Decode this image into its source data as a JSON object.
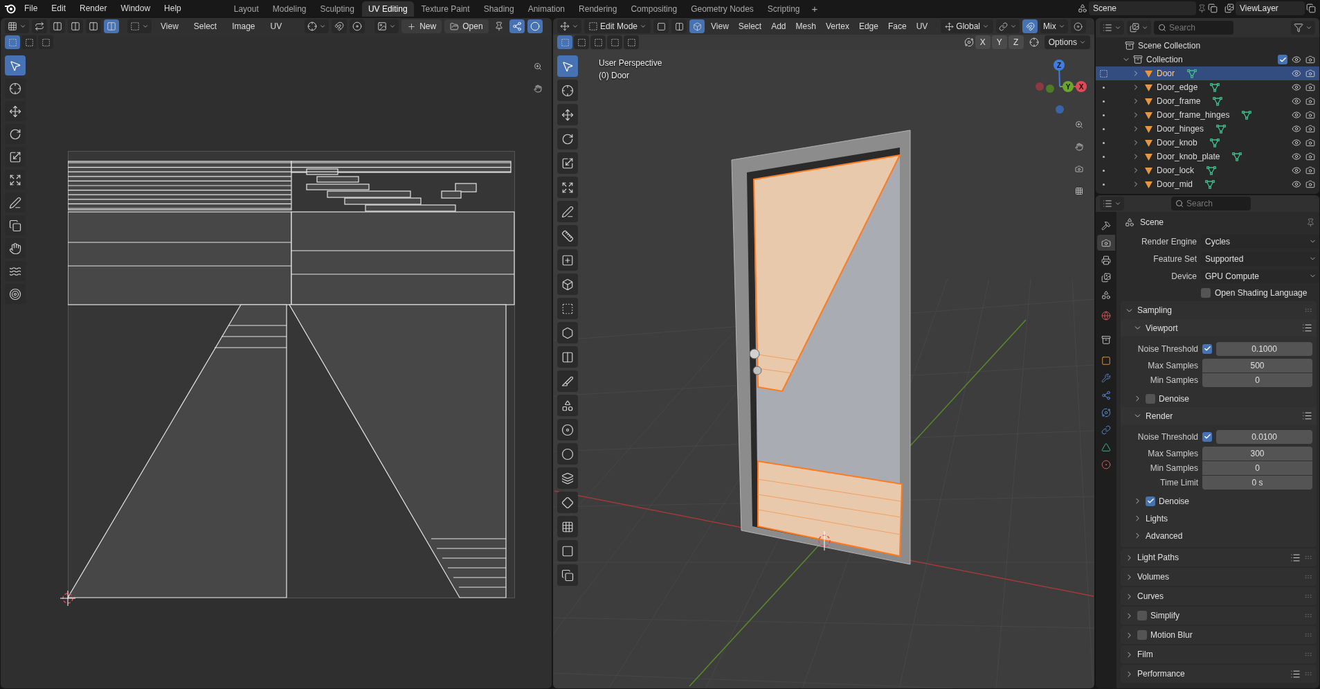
{
  "top_bar": {
    "menus": [
      "File",
      "Edit",
      "Render",
      "Window",
      "Help"
    ],
    "workspaces": [
      {
        "label": "Layout",
        "selected": false
      },
      {
        "label": "Modeling",
        "selected": false
      },
      {
        "label": "Sculpting",
        "selected": false
      },
      {
        "label": "UV Editing",
        "selected": true
      },
      {
        "label": "Texture Paint",
        "selected": false
      },
      {
        "label": "Shading",
        "selected": false
      },
      {
        "label": "Animation",
        "selected": false
      },
      {
        "label": "Rendering",
        "selected": false
      },
      {
        "label": "Compositing",
        "selected": false
      },
      {
        "label": "Geometry Nodes",
        "selected": false
      },
      {
        "label": "Scripting",
        "selected": false
      }
    ],
    "add_workspace": "+",
    "scene": "Scene",
    "view_layer": "ViewLayer"
  },
  "uv_editor": {
    "sync_modes": [
      {
        "selected": false
      },
      {
        "selected": false
      },
      {
        "selected": false
      },
      {
        "selected": true
      }
    ],
    "menus": [
      "View",
      "Select",
      "Image",
      "UV"
    ],
    "new_label": "New",
    "open_label": "Open",
    "select_modes": [
      {
        "selected": true
      },
      {
        "selected": false
      },
      {
        "selected": false
      }
    ],
    "tools": [
      {
        "kind": "select",
        "selected": true
      },
      {
        "kind": "cursor",
        "selected": false
      },
      {
        "kind": "move",
        "selected": false
      },
      {
        "kind": "rotate",
        "selected": false
      },
      {
        "kind": "scale",
        "selected": false
      },
      {
        "kind": "transform",
        "selected": false
      },
      {
        "kind": "annotate",
        "selected": false
      },
      {
        "kind": "rip",
        "selected": false
      },
      {
        "kind": "grab",
        "selected": false
      },
      {
        "kind": "relax",
        "selected": false
      },
      {
        "kind": "pinch",
        "selected": false
      }
    ]
  },
  "viewport": {
    "mode": "Edit Mode",
    "select_modes": [
      {
        "selected": false
      },
      {
        "selected": false
      },
      {
        "selected": true
      }
    ],
    "menus": [
      "View",
      "Select",
      "Add",
      "Mesh",
      "Vertex",
      "Edge",
      "Face",
      "UV"
    ],
    "orientation": "Global",
    "shading_mix": "Mix",
    "box_modes": [
      {
        "selected": true
      },
      {
        "selected": false
      },
      {
        "selected": false
      },
      {
        "selected": false
      },
      {
        "selected": false
      }
    ],
    "axis_buttons": [
      "X",
      "Y",
      "Z"
    ],
    "options": "Options",
    "view_name": "User Perspective",
    "object_name": "(0) Door",
    "gizmo_axes": [
      "X",
      "Y",
      "Z"
    ],
    "tools": [
      {
        "kind": "select",
        "selected": true
      },
      {
        "kind": "cursor",
        "selected": false
      },
      {
        "kind": "move",
        "selected": false
      },
      {
        "kind": "rotate",
        "selected": false
      },
      {
        "kind": "scale",
        "selected": false
      },
      {
        "kind": "transform",
        "selected": false
      },
      {
        "kind": "annotate",
        "selected": false
      },
      {
        "kind": "measure",
        "selected": false
      },
      {
        "kind": "add_cube",
        "selected": false
      },
      {
        "kind": "extrude",
        "selected": false
      },
      {
        "kind": "inset",
        "selected": false
      },
      {
        "kind": "bevel",
        "selected": false
      },
      {
        "kind": "loop_cut",
        "selected": false
      },
      {
        "kind": "knife",
        "selected": false
      },
      {
        "kind": "poly_build",
        "selected": false
      },
      {
        "kind": "spin",
        "selected": false
      },
      {
        "kind": "smooth",
        "selected": false
      },
      {
        "kind": "edge_slide",
        "selected": false
      },
      {
        "kind": "shrink",
        "selected": false
      },
      {
        "kind": "push_pull",
        "selected": false
      },
      {
        "kind": "shear",
        "selected": false
      },
      {
        "kind": "rip",
        "selected": false
      }
    ]
  },
  "outliner": {
    "search_placeholder": "Search",
    "scene_collection": "Scene Collection",
    "collection": {
      "name": "Collection",
      "expanded": true,
      "checked": true
    },
    "objects": [
      {
        "name": "Door",
        "selected": true
      },
      {
        "name": "Door_edge",
        "selected": false
      },
      {
        "name": "Door_frame",
        "selected": false
      },
      {
        "name": "Door_frame_hinges",
        "selected": false
      },
      {
        "name": "Door_hinges",
        "selected": false
      },
      {
        "name": "Door_knob",
        "selected": false
      },
      {
        "name": "Door_knob_plate",
        "selected": false
      },
      {
        "name": "Door_lock",
        "selected": false
      },
      {
        "name": "Door_mid",
        "selected": false
      }
    ]
  },
  "properties": {
    "search_placeholder": "Search",
    "tabs": [
      {
        "kind": "tool",
        "selected": false
      },
      {
        "kind": "render",
        "selected": true
      },
      {
        "kind": "output",
        "selected": false
      },
      {
        "kind": "view_layer",
        "selected": false
      },
      {
        "kind": "scene",
        "selected": false
      },
      {
        "kind": "world",
        "selected": false
      },
      {
        "kind": "collection",
        "selected": false
      },
      {
        "kind": "object",
        "selected": false
      },
      {
        "kind": "modifiers",
        "selected": false
      },
      {
        "kind": "particles",
        "selected": false
      },
      {
        "kind": "physics",
        "selected": false
      },
      {
        "kind": "constraints",
        "selected": false
      },
      {
        "kind": "data",
        "selected": false
      },
      {
        "kind": "material",
        "selected": false
      }
    ],
    "context": "Scene",
    "fields": [
      {
        "label": "Render Engine",
        "value": "Cycles"
      },
      {
        "label": "Feature Set",
        "value": "Supported"
      },
      {
        "label": "Device",
        "value": "GPU Compute"
      }
    ],
    "osl": {
      "label": "Open Shading Language",
      "checked": false
    },
    "sections": [
      {
        "title": "Sampling",
        "expanded": true,
        "children": [
          {
            "title": "Viewport",
            "expanded": true,
            "presets": true,
            "rows": [
              {
                "kind": "check_number",
                "label": "Noise Threshold",
                "checked": true,
                "value": "0.1000"
              },
              {
                "kind": "number",
                "label": "Max Samples",
                "value": "500"
              },
              {
                "kind": "number",
                "label": "Min Samples",
                "value": "0"
              }
            ]
          },
          {
            "title": "Denoise",
            "expanded": false,
            "checked": false
          },
          {
            "title": "Render",
            "expanded": true,
            "presets": true,
            "rows": [
              {
                "kind": "check_number",
                "label": "Noise Threshold",
                "checked": true,
                "value": "0.0100"
              },
              {
                "kind": "number",
                "label": "Max Samples",
                "value": "300"
              },
              {
                "kind": "number",
                "label": "Min Samples",
                "value": "0"
              },
              {
                "kind": "number",
                "label": "Time Limit",
                "value": "0 s"
              }
            ]
          },
          {
            "title": "Denoise",
            "expanded": false,
            "checked": true
          },
          {
            "title": "Lights",
            "expanded": false
          },
          {
            "title": "Advanced",
            "expanded": false
          }
        ]
      },
      {
        "title": "Light Paths",
        "expanded": false,
        "presets": true
      },
      {
        "title": "Volumes",
        "expanded": false
      },
      {
        "title": "Curves",
        "expanded": false
      },
      {
        "title": "Simplify",
        "expanded": false,
        "checked": false
      },
      {
        "title": "Motion Blur",
        "expanded": false,
        "checked": false
      },
      {
        "title": "Film",
        "expanded": false
      },
      {
        "title": "Performance",
        "expanded": false,
        "presets": true
      }
    ]
  }
}
